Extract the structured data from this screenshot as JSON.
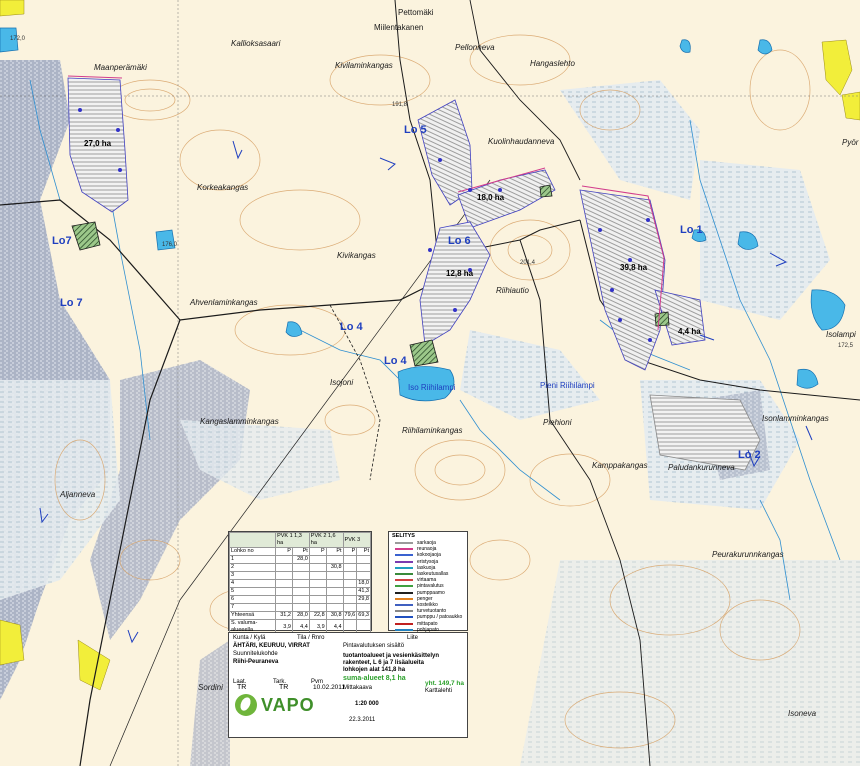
{
  "map": {
    "place_names": [
      {
        "id": "pettomaki",
        "text": "Pettomäki"
      },
      {
        "id": "mantilankari",
        "text": "Miilentakanen"
      },
      {
        "id": "pellonneva",
        "text": "Pellonneva"
      },
      {
        "id": "maanperamaki",
        "text": "Maanperämäki"
      },
      {
        "id": "kallioksaariolc",
        "text": "Kallioksasaari"
      },
      {
        "id": "kivilaminkangas",
        "text": "Kivilaminkangas"
      },
      {
        "id": "hangaslehto",
        "text": "Hangaslehto"
      },
      {
        "id": "kuolinhaudanneva",
        "text": "Kuolinhaudanneva"
      },
      {
        "id": "korkeakangas",
        "text": "Korkeakangas"
      },
      {
        "id": "kivikangas",
        "text": "Kivikangas"
      },
      {
        "id": "riihiautio",
        "text": "Riihiautio"
      },
      {
        "id": "ahvenlaminkangas",
        "text": "Ahvenlaminkangas"
      },
      {
        "id": "isojoni",
        "text": "Isojoni"
      },
      {
        "id": "kangaslamminkangas",
        "text": "Kangaslamminkangas"
      },
      {
        "id": "riihilaminkangas",
        "text": "Riihilaminkangas"
      },
      {
        "id": "piehioni",
        "text": "Piehioni"
      },
      {
        "id": "kamppakangas",
        "text": "Kamppakangas"
      },
      {
        "id": "paludanrumneva",
        "text": "Paludankurunneva"
      },
      {
        "id": "isonlamminkangas",
        "text": "Isonlamminkangas"
      },
      {
        "id": "aljanneva",
        "text": "Aljanneva"
      },
      {
        "id": "peurakuruninkangas",
        "text": "Peurakurunnkangas"
      },
      {
        "id": "isoneva",
        "text": "Isoneva"
      },
      {
        "id": "pyorinneva",
        "text": "Pyör"
      },
      {
        "id": "isolampi",
        "text": "Isolampi"
      },
      {
        "id": "sordini",
        "text": "Sordini"
      },
      {
        "id": "pieni_riihilampi",
        "text": "Pieni Riihilampi"
      },
      {
        "id": "iso_riihilampi",
        "text": "Iso Riihilampi"
      }
    ],
    "zone_labels": [
      {
        "id": "lo5",
        "text": "Lo 5"
      },
      {
        "id": "lo1",
        "text": "Lo 1"
      },
      {
        "id": "lo4a",
        "text": "Lo 4"
      },
      {
        "id": "lo4b",
        "text": "Lo 4"
      },
      {
        "id": "lo2",
        "text": "Lo 2"
      },
      {
        "id": "lo6",
        "text": "Lo 6"
      },
      {
        "id": "lo7a",
        "text": "Lo7"
      },
      {
        "id": "lo7b",
        "text": "Lo 7"
      }
    ],
    "area_labels": [
      {
        "id": "a1",
        "text": "27,0 ha"
      },
      {
        "id": "a2",
        "text": "18,0 ha"
      },
      {
        "id": "a3",
        "text": "12,8 ha"
      },
      {
        "id": "a4",
        "text": "39,8 ha"
      },
      {
        "id": "a5",
        "text": "4,4 ha"
      }
    ],
    "elevations": [
      {
        "id": "e1",
        "text": "191,8"
      },
      {
        "id": "e2",
        "text": "201,4"
      },
      {
        "id": "e3",
        "text": "172,5"
      },
      {
        "id": "e4",
        "text": "172,0"
      },
      {
        "id": "e5",
        "text": "176,0"
      }
    ]
  },
  "table": {
    "headers": [
      "PVK 1\n1,3 ha",
      "PVK 2\n1,6 ha",
      "PVK 3"
    ],
    "subheaders": [
      "Lohko no",
      "P",
      "Pt",
      "P",
      "Pt",
      "P",
      "Pt"
    ],
    "rows": [
      [
        "1",
        "",
        "28,0",
        "",
        "",
        "",
        ""
      ],
      [
        "2",
        "",
        "",
        "",
        "30,8",
        "",
        ""
      ],
      [
        "3",
        "",
        "",
        "",
        "",
        "",
        ""
      ],
      [
        "4",
        "",
        "",
        "",
        "",
        "",
        "18,0"
      ],
      [
        "5",
        "",
        "",
        "",
        "",
        "",
        "41,3"
      ],
      [
        "6",
        "",
        "",
        "",
        "",
        "",
        "29,8"
      ],
      [
        "7",
        "",
        "",
        "",
        "",
        "",
        ""
      ]
    ],
    "total_label": "Yhteensä",
    "totals": [
      "31,2",
      "28,0",
      "22,8",
      "30,8",
      "79,6",
      "69,3"
    ],
    "suma_label": "S. valuma-alueeella",
    "suma": [
      "3,9",
      "4,4",
      "3,9",
      "4,4"
    ]
  },
  "legend": {
    "title": "SELITYS",
    "items": [
      {
        "text": "sarkaoja",
        "color": "#9a9a9a"
      },
      {
        "text": "reunaoja",
        "color": "#d23c8c"
      },
      {
        "text": "kokoojaoja",
        "color": "#3a62d0"
      },
      {
        "text": "eristysoja",
        "color": "#7a3cb0"
      },
      {
        "text": "laskuoja",
        "color": "#20a0c0"
      },
      {
        "text": "laskeutusallas",
        "color": "#3a8a3a"
      },
      {
        "text": "virtaama",
        "color": "#d04040"
      },
      {
        "text": "pintavalutus",
        "color": "#40a040"
      },
      {
        "text": "pumppaamo",
        "color": "#202020"
      },
      {
        "text": "penger",
        "color": "#e08020"
      },
      {
        "text": "kosteikko",
        "color": "#4060c0"
      },
      {
        "text": "turvetuotanto",
        "color": "#888888"
      },
      {
        "text": "pumppu / patoaukko",
        "color": "#2050c0"
      },
      {
        "text": "mittapato",
        "color": "#c02020"
      },
      {
        "text": "pohjapato",
        "color": "#2080c0"
      },
      {
        "text": "suma",
        "color": "#20a020"
      }
    ]
  },
  "titleblock": {
    "kunta_label": "Kunta / Kylä",
    "tila_label": "Tila / Rnro",
    "liite_label": "Liite",
    "municipality": "ÄHTÄRI, KEURUU, VIRRAT",
    "subtitle": "Suunnitelukohde",
    "site": "Riihi-Peuraneva",
    "plan_title": "Pintavalutuksen sisältö",
    "desc1": "tuotantoalueet ja vesienkäsittelyn",
    "desc2": "rakenteet, L 6 ja 7 lisäalueita",
    "desc3": "lohkojen alat 141,8 ha",
    "suma": "suma-alueet 8,1 ha",
    "total": "yht. 149,7 ha",
    "scale_label": "Mittakaava",
    "scale": "1:20 000",
    "map_label": "Karttalehti",
    "laat_label": "Laat.",
    "laat": "TR",
    "tark_label": "Tark.",
    "tark": "TR",
    "pvm_label": "Pvm",
    "pvm": "10.02.2011",
    "muutos": "22.3.2011",
    "logo": "VAPO"
  }
}
